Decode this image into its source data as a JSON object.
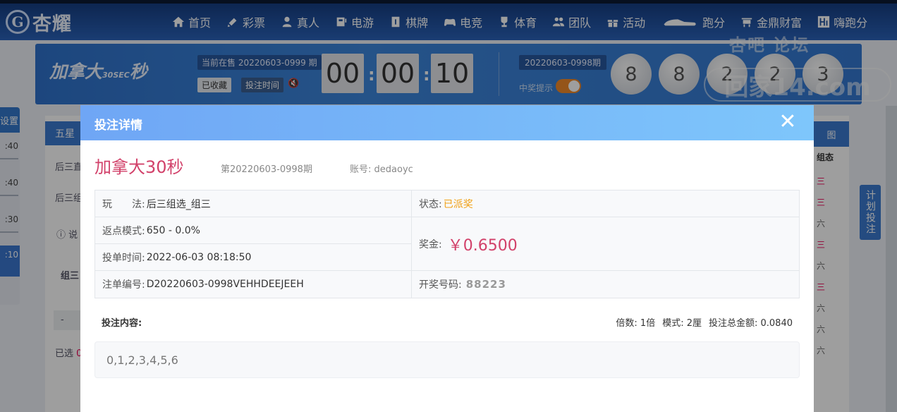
{
  "brand": {
    "logo_mark": "G",
    "name": "杏耀"
  },
  "nav": [
    {
      "label": "首页",
      "icon": "home-icon"
    },
    {
      "label": "彩票",
      "icon": "lottery-icon"
    },
    {
      "label": "真人",
      "icon": "live-icon"
    },
    {
      "label": "电游",
      "icon": "slot-icon"
    },
    {
      "label": "棋牌",
      "icon": "cards-icon"
    },
    {
      "label": "电竞",
      "icon": "gamepad-icon"
    },
    {
      "label": "体育",
      "icon": "trophy-icon"
    },
    {
      "label": "团队",
      "icon": "team-icon"
    },
    {
      "label": "活动",
      "icon": "gift-icon"
    },
    {
      "label": "跑分",
      "icon": "car-icon"
    },
    {
      "label": "金鼎财富",
      "icon": "ding-icon"
    },
    {
      "label": "嗨跑分",
      "icon": "hi-icon"
    }
  ],
  "game_header": {
    "logo_text": "加拿大",
    "logo_sec": "30SEC",
    "logo_suffix": "秒",
    "on_sale": "当前在售 20220603-0999 期",
    "favorited_btn": "已收藏",
    "bet_time_btn": "投注时间",
    "timer": [
      "00",
      "00",
      "10"
    ],
    "prev_issue": "20220603-0998期",
    "win_notify": "中奖提示",
    "balls": [
      "8",
      "8",
      "2",
      "2",
      "3"
    ]
  },
  "watermark": {
    "top": "杏吧  论坛",
    "bottom": "回家14.com"
  },
  "background": {
    "left_tab": "设置",
    "left_rows": [
      ":40",
      ":40",
      ":30",
      ":10"
    ],
    "tab_label": "五星",
    "row1": "后三直",
    "row2": "后三组",
    "note": "说",
    "group": "组三",
    "minus": "-",
    "selected": "已选",
    "selected_count": "0",
    "right_tab": "图",
    "right_head": "组态",
    "right_marks": [
      "三",
      "三",
      "六",
      "三",
      "六",
      "三",
      "六",
      "六",
      "六"
    ],
    "plan_btn": "计划投注"
  },
  "modal": {
    "title": "投注详情",
    "close": "✕",
    "lottery_name": "加拿大30秒",
    "issue": "第20220603-0998期",
    "account_label": "账号:",
    "account": "dedaoyc",
    "play_label": "玩　　法:",
    "play_value": "后三组选_组三",
    "status_label": "状态:",
    "status_value": "已派奖",
    "rebate_label": "返点模式:",
    "rebate_value": "650 - 0.0%",
    "bet_time_label": "投单时间:",
    "bet_time_value": "2022-06-03 08:18:50",
    "prize_label": "奖金:",
    "prize_value": "￥0.6500",
    "order_label": "注单编号:",
    "order_value": "D20220603-0998VEHHDEEJEEH",
    "draw_label": "开奖号码:",
    "draw_value": "88223",
    "content_label": "投注内容:",
    "multiple": "倍数: 1倍",
    "mode": "模式: 2厘",
    "total": "投注总金额: 0.0840",
    "content_value": "0,1,2,3,4,5,6"
  },
  "colors": {
    "accent": "#3a7acf",
    "prize": "#d2416a",
    "status": "#f0a015",
    "modal_header": "#7ab8f8"
  }
}
